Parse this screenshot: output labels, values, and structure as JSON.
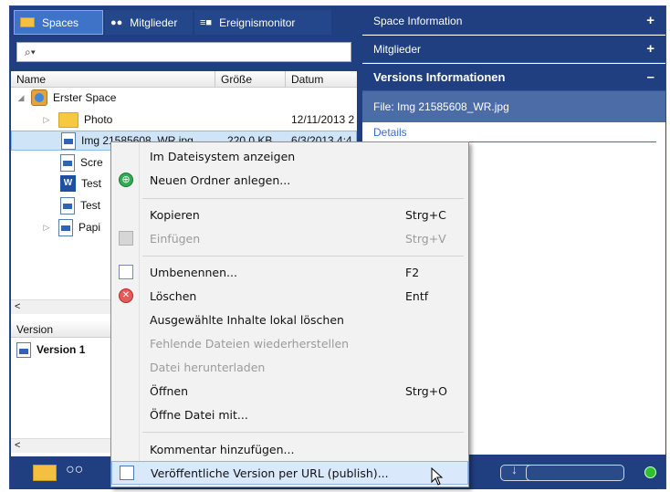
{
  "tabs": {
    "spaces": "Spaces",
    "mitglieder": "Mitglieder",
    "ereignismonitor": "Ereignismonitor"
  },
  "search": {
    "value": "⌕▾"
  },
  "columns": {
    "name": "Name",
    "size": "Größe",
    "date": "Datum"
  },
  "tree": {
    "root": "Erster Space",
    "items": [
      {
        "name": "Photo",
        "date": "12/11/2013 2"
      },
      {
        "name": "Img 21585608_WR.jpg",
        "size": "220,0 KB",
        "date": "6/3/2013 4:4"
      },
      {
        "name": "Scre"
      },
      {
        "name": "Test"
      },
      {
        "name": "Test"
      },
      {
        "name": "Papi"
      }
    ]
  },
  "version": {
    "header": "Version",
    "row": "Version 1"
  },
  "right": {
    "space_info": "Space Information",
    "mitglieder": "Mitglieder",
    "versions": "Versions Informationen",
    "file": "File: Img 21585608_WR.jpg",
    "details": "Details",
    "plus": "+",
    "minus": "–"
  },
  "menu": {
    "items": [
      {
        "label": "Im Dateisystem anzeigen",
        "shortcut": "",
        "disabled": false
      },
      {
        "label": "Neuen Ordner anlegen...",
        "shortcut": "",
        "disabled": false
      },
      {
        "label": "Kopieren",
        "shortcut": "Strg+C",
        "disabled": false
      },
      {
        "label": "Einfügen",
        "shortcut": "Strg+V",
        "disabled": true
      },
      {
        "label": "Umbenennen...",
        "shortcut": "F2",
        "disabled": false
      },
      {
        "label": "Löschen",
        "shortcut": "Entf",
        "disabled": false
      },
      {
        "label": "Ausgewählte Inhalte lokal löschen",
        "shortcut": "",
        "disabled": false
      },
      {
        "label": "Fehlende Dateien wiederherstellen",
        "shortcut": "",
        "disabled": true
      },
      {
        "label": "Datei herunterladen",
        "shortcut": "",
        "disabled": true
      },
      {
        "label": "Öffnen",
        "shortcut": "Strg+O",
        "disabled": false
      },
      {
        "label": "Öffne Datei mit...",
        "shortcut": "",
        "disabled": false
      },
      {
        "label": "Kommentar hinzufügen...",
        "shortcut": "",
        "disabled": false
      },
      {
        "label": "Veröffentliche Version per URL (publish)...",
        "shortcut": "",
        "disabled": false
      }
    ]
  },
  "colors": {
    "frame": "#1f3f80",
    "tab_active": "#3f73c8",
    "file_strip": "#4c6ca8",
    "status": "#2ec02e"
  },
  "icons": [
    "folder-icon",
    "people-icon",
    "monitor-icon",
    "search-icon",
    "plus-icon",
    "minus-icon",
    "new-folder-icon",
    "paste-icon",
    "rename-icon",
    "delete-icon",
    "publish-icon",
    "status-dot-icon",
    "mouse-cursor-icon"
  ]
}
